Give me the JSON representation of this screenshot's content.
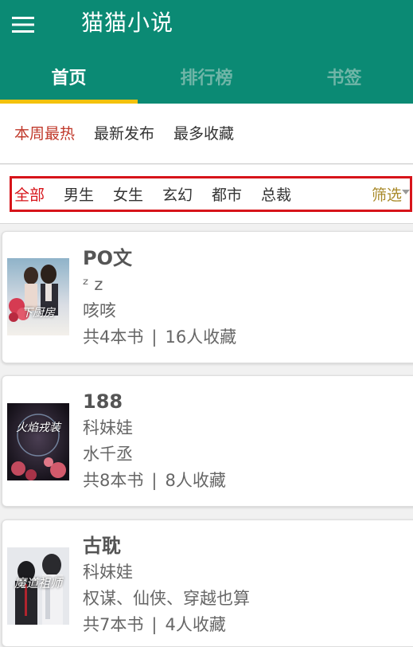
{
  "app": {
    "title": "猫猫小说",
    "menu_icon": "hamburger-menu-icon"
  },
  "tabs": [
    {
      "label": "首页",
      "active": true
    },
    {
      "label": "排行榜",
      "active": false
    },
    {
      "label": "书签",
      "active": false
    }
  ],
  "sort": {
    "items": [
      "本周最热",
      "最新发布",
      "最多收藏"
    ],
    "active_index": 0
  },
  "filter": {
    "items": [
      "全部",
      "男生",
      "女生",
      "玄幻",
      "都市",
      "总裁"
    ],
    "active_index": 0,
    "select_label": "筛选"
  },
  "colors": {
    "primary": "#0b8a74",
    "tab_indicator": "#f4c20d",
    "active_red": "#d7141a",
    "select_gold": "#a98a2a"
  },
  "books": [
    {
      "title": "PO文",
      "author": "ᶻ z",
      "desc": "咳咳",
      "count": "共4本书",
      "favorites": "16人收藏",
      "cover_icon": "romance-couple-cover",
      "cover_text": "下厨房"
    },
    {
      "title": "188",
      "author": "科妹娃",
      "desc": "水千丞",
      "count": "共8本书",
      "favorites": "8人收藏",
      "cover_icon": "flame-armor-cover",
      "cover_text": "火焰戎装"
    },
    {
      "title": "古耽",
      "author": "科妹娃",
      "desc": "权谋、仙侠、穿越也算",
      "count": "共7本书",
      "favorites": "4人收藏",
      "cover_icon": "demon-master-cover",
      "cover_text": "魔道祖师"
    }
  ],
  "separator": "|"
}
